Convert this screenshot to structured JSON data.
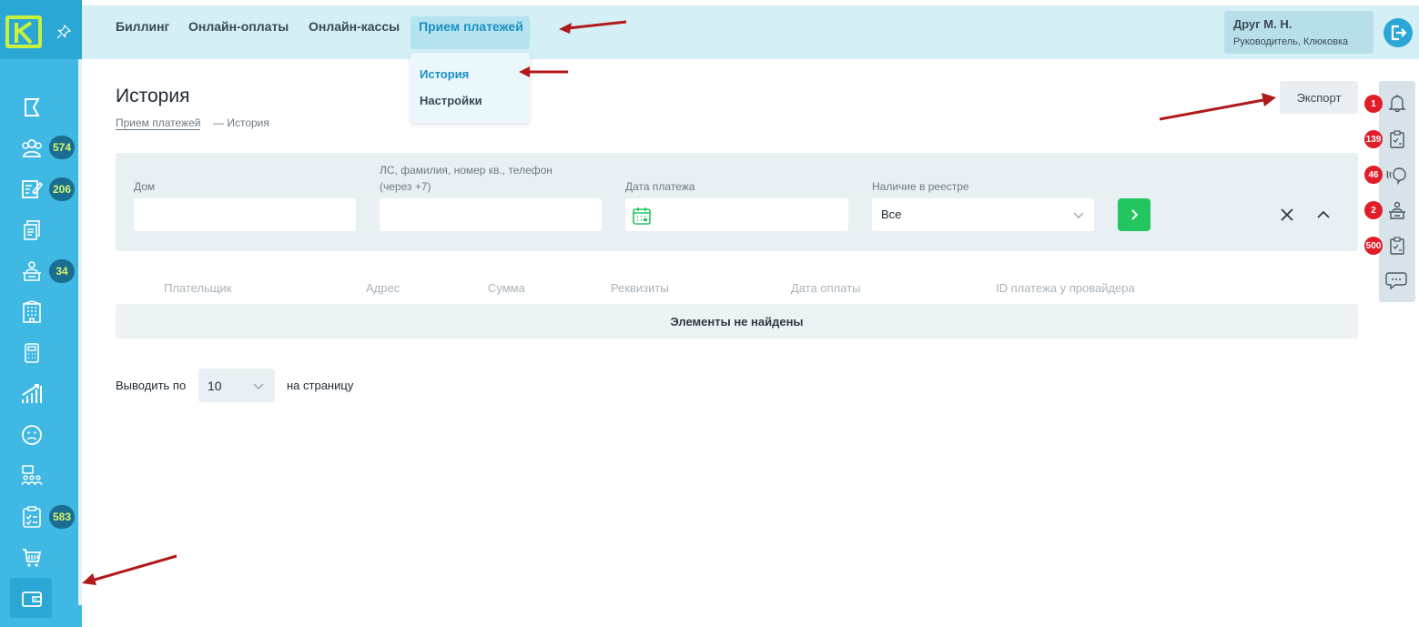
{
  "sidebar": {
    "badges": {
      "users": "574",
      "tasks": "206",
      "meters": "34",
      "checklist": "583"
    },
    "icons": [
      "flag-icon",
      "users-icon",
      "edit-list-icon",
      "documents-icon",
      "person-desk-icon",
      "building-icon",
      "calculator-icon",
      "chart-growth-icon",
      "sad-face-icon",
      "org-chart-icon",
      "checklist-icon",
      "cart-icon",
      "wallet-icon"
    ]
  },
  "header": {
    "tabs": [
      "Биллинг",
      "Онлайн-оплаты",
      "Онлайн-кассы"
    ],
    "active_tab": "Прием платежей",
    "user": {
      "name": "Друг М. Н.",
      "role": "Руководитель, Клюковка"
    }
  },
  "dropdown": {
    "items": [
      "История",
      "Настройки"
    ]
  },
  "page": {
    "title": "История",
    "breadcrumb": {
      "parent": "Прием платежей",
      "current": "— История"
    },
    "export_label": "Экспорт"
  },
  "filters": {
    "house_label": "Дом",
    "account_label_line1": "ЛС, фамилия, номер кв., телефон",
    "account_label_line2": "(через +7)",
    "date_label": "Дата платежа",
    "registry_label": "Наличие в реестре",
    "registry_value": "Все"
  },
  "table": {
    "columns": [
      "Плательщик",
      "Адрес",
      "Сумма",
      "Реквизиты",
      "Дата оплаты",
      "ID платежа у провайдера"
    ],
    "empty_text": "Элементы не найдены"
  },
  "pagination": {
    "label": "Выводить по",
    "value": "10",
    "suffix": "на страницу"
  },
  "right_panel": {
    "badges": [
      "1",
      "139",
      "46",
      "2",
      "500"
    ]
  },
  "colors": {
    "sidebar": "#3fb8e3",
    "topbar": "#d4eff6",
    "accent": "#1a8fc4",
    "badge_red": "#e11d2a",
    "go_green": "#22c55e"
  }
}
